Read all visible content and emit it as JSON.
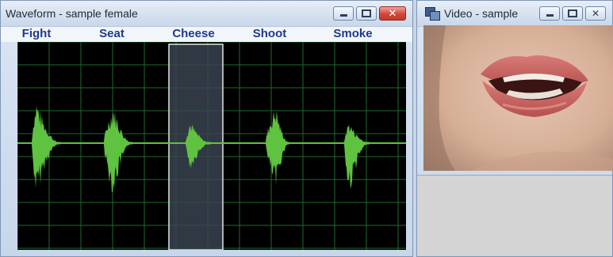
{
  "waveform_window": {
    "title": "Waveform - sample female",
    "words": [
      "Fight",
      "Seat",
      "Cheese",
      "Shoot",
      "Smoke"
    ],
    "selected_word": "Cheese",
    "wave_color": "#5fc241",
    "grid_color": "#1f6a2a",
    "selection_color": "#3a4452"
  },
  "video_window": {
    "title": "Video - sample",
    "content": "mouth-closeup"
  },
  "icons": {
    "minimize": "minimize-icon",
    "maximize": "maximize-icon",
    "close": "close-icon",
    "app": "video-window-icon"
  }
}
